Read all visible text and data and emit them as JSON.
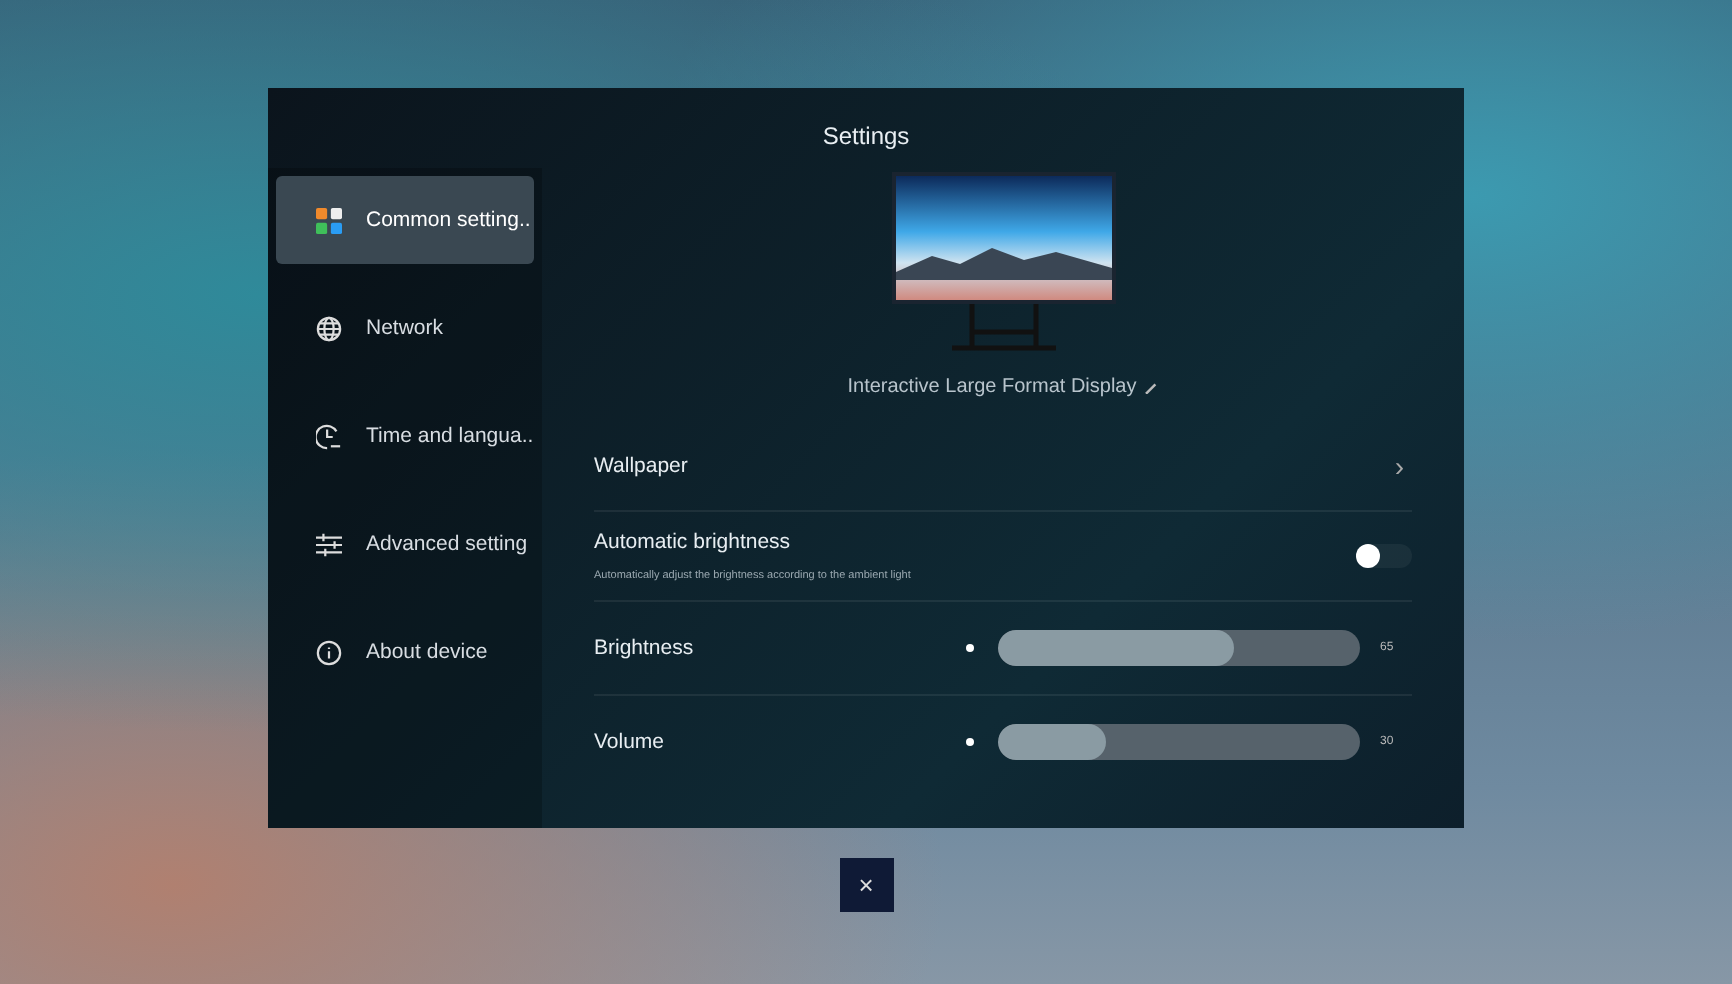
{
  "window": {
    "title": "Settings"
  },
  "sidebar": {
    "items": [
      {
        "label": "Common setting..",
        "selected": true
      },
      {
        "label": "Network",
        "selected": false
      },
      {
        "label": "Time and langua..",
        "selected": false
      },
      {
        "label": "Advanced setting",
        "selected": false
      },
      {
        "label": "About device",
        "selected": false
      }
    ]
  },
  "device": {
    "name": "Interactive Large Format Display"
  },
  "settings": [
    {
      "kind": "link",
      "label": "Wallpaper",
      "arrow": "›"
    },
    {
      "kind": "toggle",
      "label": "Automatic brightness",
      "description": "Automatically adjust the brightness according to the ambient light",
      "on": false
    },
    {
      "kind": "slider",
      "label": "Brightness",
      "level": 0.65,
      "reading": "65"
    },
    {
      "kind": "slider",
      "label": "Volume",
      "level": 0.3,
      "reading": "30"
    }
  ],
  "close_button": {
    "label": "×"
  }
}
